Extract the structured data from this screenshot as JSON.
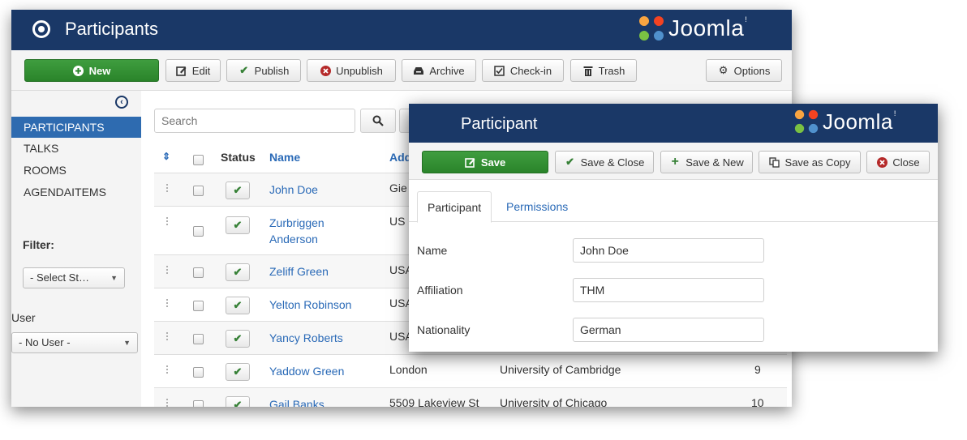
{
  "brand": {
    "name": "Joomla!",
    "word": "Joomla",
    "mark": "!"
  },
  "list_window": {
    "title": "Participants",
    "toolbar": {
      "new": "New",
      "edit": "Edit",
      "publish": "Publish",
      "unpublish": "Unpublish",
      "archive": "Archive",
      "checkin": "Check-in",
      "trash": "Trash",
      "options": "Options"
    },
    "sidebar": {
      "items": [
        {
          "label": "PARTICIPANTS",
          "active": true
        },
        {
          "label": "TALKS",
          "active": false
        },
        {
          "label": "ROOMS",
          "active": false
        },
        {
          "label": "AGENDAITEMS",
          "active": false
        }
      ],
      "filter_label": "Filter:",
      "status_select": "- Select St…",
      "user_label": "User",
      "user_select": "- No User -"
    },
    "search": {
      "placeholder": "Search"
    },
    "table": {
      "headers": {
        "status": "Status",
        "name": "Name",
        "address": "Add"
      },
      "rows": [
        {
          "name": "John Doe",
          "address": "Gie",
          "affiliation": "",
          "id": ""
        },
        {
          "name": "Zurbriggen Anderson",
          "address": "US",
          "affiliation": "",
          "id": ""
        },
        {
          "name": "Zeliff Green",
          "address": "USA",
          "affiliation": "",
          "id": ""
        },
        {
          "name": "Yelton Robinson",
          "address": "USA",
          "affiliation": "",
          "id": ""
        },
        {
          "name": "Yancy Roberts",
          "address": "USA",
          "affiliation": "",
          "id": ""
        },
        {
          "name": "Yaddow Green",
          "address": "London",
          "affiliation": "University of Cambridge",
          "id": "9"
        },
        {
          "name": "Gail Banks",
          "address": "5509 Lakeview St",
          "affiliation": "University of Chicago",
          "id": "10"
        }
      ]
    }
  },
  "edit_window": {
    "title": "Participant",
    "toolbar": {
      "save": "Save",
      "save_close": "Save & Close",
      "save_new": "Save & New",
      "save_copy": "Save as Copy",
      "close": "Close"
    },
    "tabs": [
      {
        "label": "Participant"
      },
      {
        "label": "Permissions"
      }
    ],
    "fields": {
      "name": {
        "label": "Name",
        "value": "John Doe"
      },
      "affiliation": {
        "label": "Affiliation",
        "value": "THM"
      },
      "nationality": {
        "label": "Nationality",
        "value": "German"
      }
    }
  },
  "colors": {
    "header": "#1a3867",
    "accent_green": "#2a842a",
    "link_blue": "#2a6ab7",
    "active_nav": "#2e6bb0"
  }
}
